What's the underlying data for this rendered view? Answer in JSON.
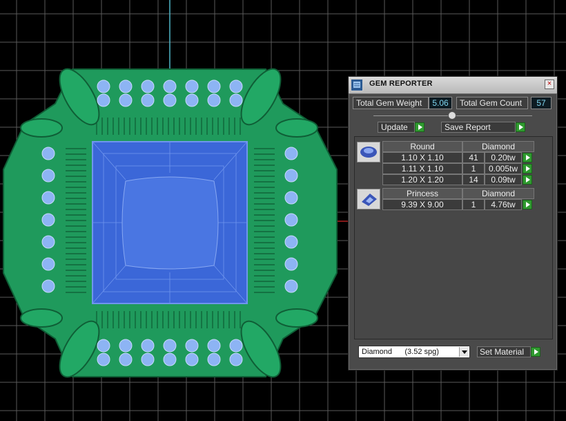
{
  "panel": {
    "title": "GEM REPORTER",
    "close_glyph": "×",
    "total_weight_label": "Total Gem Weight",
    "total_weight_value": "5.06",
    "total_count_label": "Total Gem Count",
    "total_count_value": "57",
    "update_label": "Update",
    "save_report_label": "Save Report",
    "groups": [
      {
        "shape": "Round",
        "material": "Diamond",
        "icon": "round-gem-icon",
        "rows": [
          {
            "size": "1.10 X 1.10",
            "count": "41",
            "weight": "0.20tw"
          },
          {
            "size": "1.11 X 1.10",
            "count": "1",
            "weight": "0.005tw"
          },
          {
            "size": "1.20 X 1.20",
            "count": "14",
            "weight": "0.09tw"
          }
        ]
      },
      {
        "shape": "Princess",
        "material": "Diamond",
        "icon": "princess-gem-icon",
        "rows": [
          {
            "size": "9.39 X 9.00",
            "count": "1",
            "weight": "4.76tw"
          }
        ]
      }
    ],
    "material_select_value": "Diamond      (3.52 spg)",
    "set_material_label": "Set Material"
  },
  "colors": {
    "viewport_bg": "#000000",
    "grid": "#5a5a5a",
    "metal": "#1f9a5c",
    "stone": "#3b67d8",
    "melee": "#8db4f4",
    "value_text": "#7fd6f0",
    "play_button": "#2f9a2f"
  }
}
